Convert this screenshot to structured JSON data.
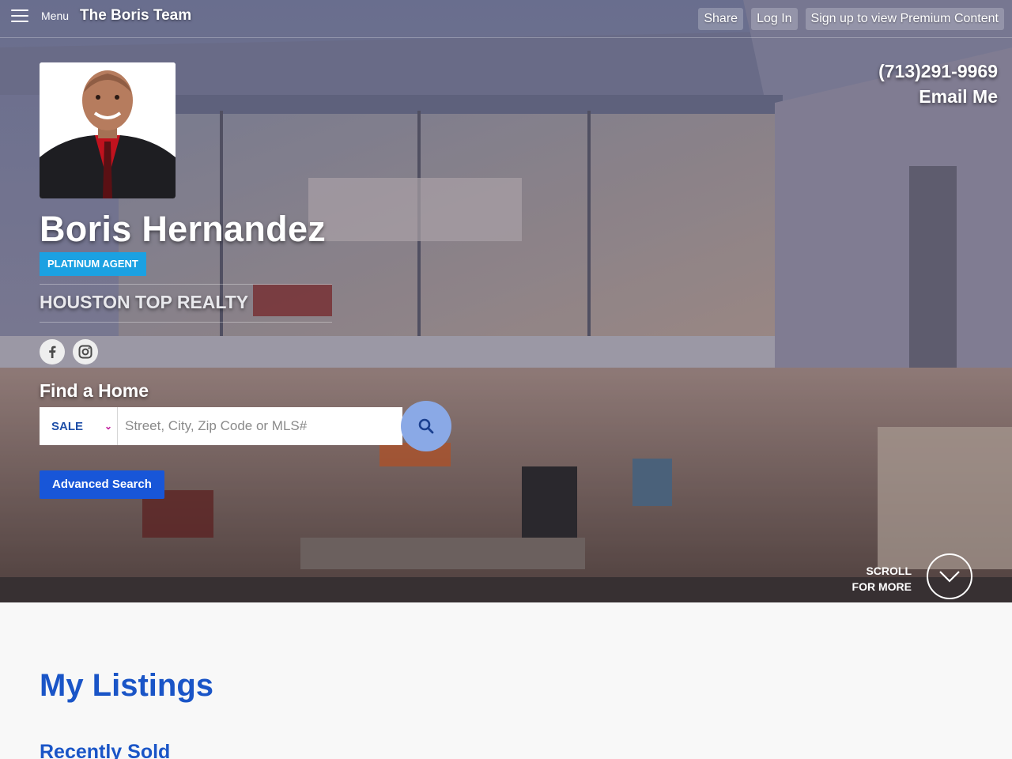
{
  "header": {
    "menu_label": "Menu",
    "brand": "The Boris Team",
    "actions": [
      "Share",
      "Log In",
      "Sign up to view Premium Content"
    ]
  },
  "contact": {
    "phone": "(713)291-9969",
    "email": "Email Me"
  },
  "agent": {
    "name": "Boris Hernandez",
    "badge": "PLATINUM AGENT",
    "company": "HOUSTON TOP REALTY",
    "social": [
      "facebook-icon",
      "instagram-icon"
    ]
  },
  "search": {
    "heading": "Find a Home",
    "type_selected": "SALE",
    "placeholder": "Street, City, Zip Code or MLS#",
    "advanced_label": "Advanced Search"
  },
  "scroll": {
    "line1": "SCROLL",
    "line2": "FOR MORE"
  },
  "main": {
    "title": "My Listings",
    "subtitle": "Recently Sold"
  },
  "colors": {
    "accent": "#1a55c7",
    "badge": "#1ba1e2",
    "button": "#1856d8",
    "search_button": "#8aa9e6"
  }
}
